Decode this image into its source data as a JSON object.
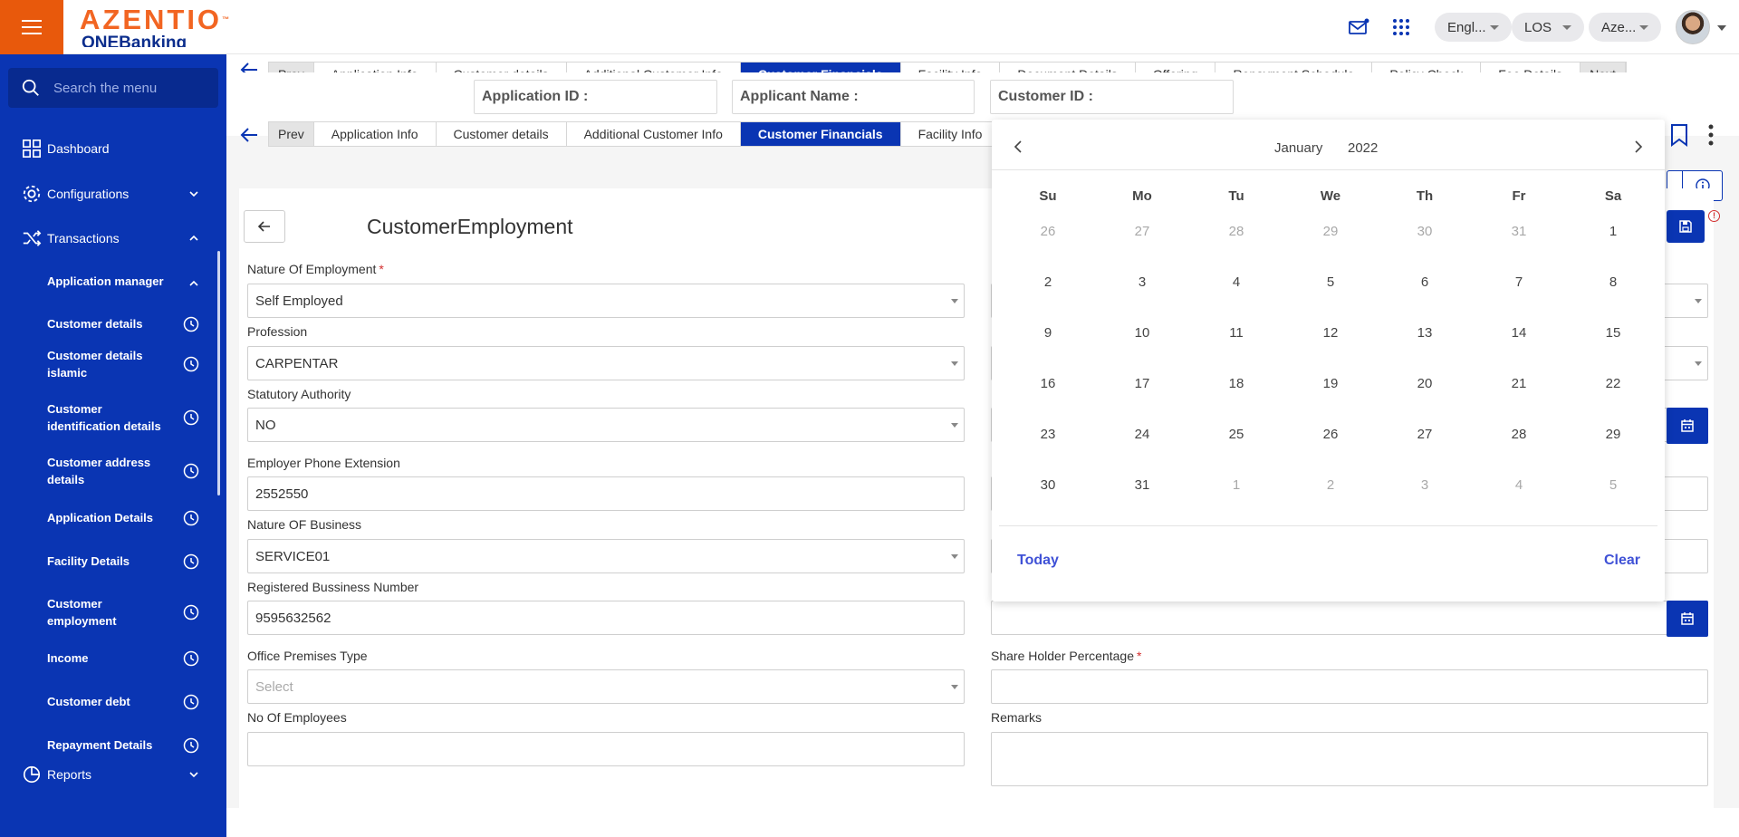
{
  "header": {
    "logo_text": "AZENTIO",
    "logo_tm": "™",
    "logo_sub": "ONEBanking",
    "language": "Engl...",
    "module": "LOS",
    "entity": "Aze..."
  },
  "sidebar": {
    "search_placeholder": "Search the menu",
    "items": [
      {
        "label": "Dashboard"
      },
      {
        "label": "Configurations"
      },
      {
        "label": "Transactions"
      },
      {
        "label": "Reports"
      }
    ],
    "sub_items": [
      {
        "label": "Application manager"
      },
      {
        "label": "Customer details"
      },
      {
        "label": "Customer details islamic"
      },
      {
        "label": "Customer identification details"
      },
      {
        "label": "Customer address details"
      },
      {
        "label": "Application Details"
      },
      {
        "label": "Facility Details"
      },
      {
        "label": "Customer employment"
      },
      {
        "label": "Income"
      },
      {
        "label": "Customer debt"
      },
      {
        "label": "Repayment Details"
      }
    ]
  },
  "tabs": {
    "prev": "Prev",
    "next": "Next",
    "items": [
      "Application Info",
      "Customer details",
      "Additional Customer Info",
      "Customer Financials",
      "Facility Info"
    ],
    "ghost_items": [
      "Application Info",
      "Customer details",
      "Additional Customer Info",
      "Customer Financials",
      "Facility Info",
      "Document Details",
      "Offering",
      "Repayment Schedule",
      "Policy Check",
      "Fee Details"
    ],
    "active": "Customer Financials"
  },
  "ids": {
    "application_id": "Application ID :",
    "applicant_name": "Applicant Name :",
    "customer_id": "Customer ID :"
  },
  "page": {
    "title": "CustomerEmployment"
  },
  "form": {
    "nature_of_employment": {
      "label": "Nature Of Employment",
      "value": "Self Employed",
      "required": "*"
    },
    "profession": {
      "label": "Profession",
      "value": "CARPENTAR"
    },
    "statutory_authority": {
      "label": "Statutory Authority",
      "value": "NO"
    },
    "employer_phone_extension": {
      "label": "Employer Phone Extension",
      "value": "2552550"
    },
    "nature_of_business": {
      "label": "Nature OF Business",
      "value": "SERVICE01"
    },
    "registered_business_number": {
      "label": "Registered Bussiness Number",
      "value": "9595632562"
    },
    "office_premises_type": {
      "label": "Office Premises Type",
      "placeholder": "Select"
    },
    "no_of_employees": {
      "label": "No Of Employees",
      "value": ""
    },
    "share_holder_percentage": {
      "label": "Share Holder Percentage",
      "value": "",
      "required": "*"
    },
    "remarks": {
      "label": "Remarks",
      "value": ""
    }
  },
  "calendar": {
    "month": "January",
    "year": "2022",
    "weekdays": [
      "Su",
      "Mo",
      "Tu",
      "We",
      "Th",
      "Fr",
      "Sa"
    ],
    "weeks": [
      [
        "26",
        "27",
        "28",
        "29",
        "30",
        "31",
        "1"
      ],
      [
        "2",
        "3",
        "4",
        "5",
        "6",
        "7",
        "8"
      ],
      [
        "9",
        "10",
        "11",
        "12",
        "13",
        "14",
        "15"
      ],
      [
        "16",
        "17",
        "18",
        "19",
        "20",
        "21",
        "22"
      ],
      [
        "23",
        "24",
        "25",
        "26",
        "27",
        "28",
        "29"
      ],
      [
        "30",
        "31",
        "1",
        "2",
        "3",
        "4",
        "5"
      ]
    ],
    "other_month": [
      [
        true,
        true,
        true,
        true,
        true,
        true,
        false
      ],
      [
        false,
        false,
        false,
        false,
        false,
        false,
        false
      ],
      [
        false,
        false,
        false,
        false,
        false,
        false,
        false
      ],
      [
        false,
        false,
        false,
        false,
        false,
        false,
        false
      ],
      [
        false,
        false,
        false,
        false,
        false,
        false,
        false
      ],
      [
        false,
        false,
        true,
        true,
        true,
        true,
        true
      ]
    ],
    "today_label": "Today",
    "clear_label": "Clear"
  },
  "colors": {
    "brand_orange": "#e8590c",
    "primary_blue": "#0a35b3",
    "link_blue": "#3f51d6",
    "required_red": "#d32f2f"
  }
}
